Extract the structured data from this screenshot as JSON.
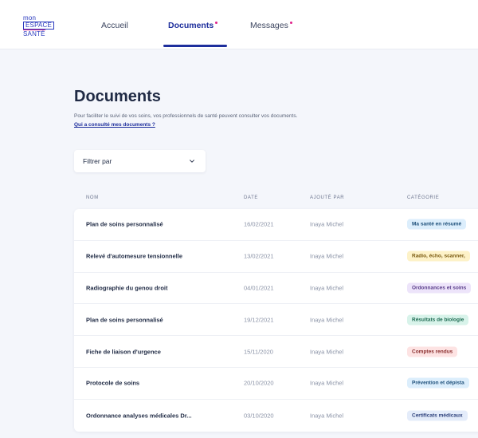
{
  "header": {
    "logo": {
      "line1": "mon",
      "line2": "ESPACE",
      "line3": "SANTÉ"
    },
    "tabs": [
      {
        "label": "Accueil",
        "active": false,
        "dot": false
      },
      {
        "label": "Documents",
        "active": true,
        "dot": true
      },
      {
        "label": "Messages",
        "active": false,
        "dot": true
      }
    ],
    "accent_color": "#1d2e9c",
    "dot_color": "#e0218a"
  },
  "page": {
    "title": "Documents",
    "subtitle": "Pour faciliter le suivi de vos soins, vos professionnels de santé peuvent consulter vos documents.",
    "consult_link": "Qui a consulté mes documents ?"
  },
  "filter": {
    "label": "Filtrer par",
    "icon": "chevron-down-icon"
  },
  "table": {
    "columns": [
      "NOM",
      "DATE",
      "AJOUTÉ PAR",
      "CATÉGORIE"
    ],
    "rows": [
      {
        "name": "Plan de soins personnalisé",
        "date": "16/02/2021",
        "author": "Inaya Michel",
        "category": "Ma santé en résumé",
        "badge_bg": "#dceefc",
        "badge_fg": "#1d4f7a"
      },
      {
        "name": "Relevé d'automesure tensionnelle",
        "date": "13/02/2021",
        "author": "Inaya Michel",
        "category": "Radio, écho, scanner,",
        "badge_bg": "#fdf2c8",
        "badge_fg": "#7a5a10"
      },
      {
        "name": "Radiographie du genou droit",
        "date": "04/01/2021",
        "author": "Inaya Michel",
        "category": "Ordonnances et soins",
        "badge_bg": "#ede4fa",
        "badge_fg": "#5a3d8a"
      },
      {
        "name": "Plan de soins personnalisé",
        "date": "19/12/2021",
        "author": "Inaya Michel",
        "category": "Résultats de biologie",
        "badge_bg": "#d8f3ea",
        "badge_fg": "#1e6b52"
      },
      {
        "name": "Fiche de liaison d'urgence",
        "date": "15/11/2020",
        "author": "Inaya Michel",
        "category": "Comptes rendus",
        "badge_bg": "#fde3e3",
        "badge_fg": "#8a2d2d"
      },
      {
        "name": "Protocole de soins",
        "date": "20/10/2020",
        "author": "Inaya Michel",
        "category": "Prévention et dépista",
        "badge_bg": "#dceefc",
        "badge_fg": "#1d4f7a"
      },
      {
        "name": "Ordonnance analyses médicales Dr...",
        "date": "03/10/2020",
        "author": "Inaya Michel",
        "category": "Certificats médicaux",
        "badge_bg": "#e4ecfa",
        "badge_fg": "#2b3f7a"
      }
    ]
  }
}
